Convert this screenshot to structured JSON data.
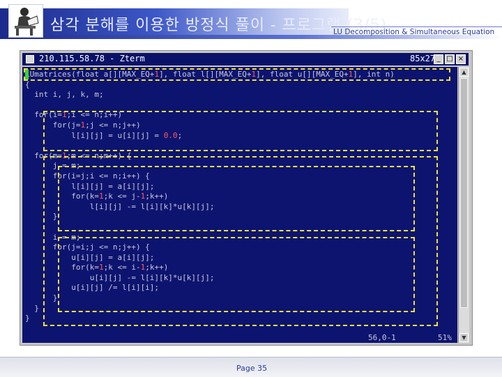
{
  "slide": {
    "title": "삼각 분해를 이용한 방정식 풀이 - 프로그램 (3/5)",
    "subtitle": "LU Decomposition & Simultaneous Equation",
    "page_label": "Page 35"
  },
  "window": {
    "title": "210.115.58.78 - Zterm",
    "size": "85x27",
    "minimize_label": "_",
    "maximize_label": "□",
    "close_label": "×"
  },
  "terminal": {
    "colors": {
      "background": "#0d1470",
      "text": "#c9c9d6",
      "number": "#ff5a5a",
      "cursor": "#3bd23b",
      "highlight_box": "#f2e23a"
    },
    "code_lines": [
      "LUmatrices(float a[][MAX_EQ+1], float l[][MAX_EQ+1], float u[][MAX_EQ+1], int n)",
      "{",
      "  int i, j, k, m;",
      "",
      "  for(i=1;i <= n;i++)",
      "      for(j=1;j <= n;j++)",
      "          l[i][j] = u[i][j] = 0.0;",
      "",
      "  for(m=1;m <= n;m++) {",
      "      j = m;",
      "      for(i=j;i <= n;i++) {",
      "          l[i][j] = a[i][j];",
      "          for(k=1;k <= j-1;k++)",
      "              l[i][j] -= l[i][k]*u[k][j];",
      "      }",
      "",
      "      i = m;",
      "      for(j=i;j <= n;j++) {",
      "          u[i][j] = a[i][j];",
      "          for(k=1;k <= i-1;k++)",
      "              u[i][j] -= l[i][k]*u[k][j];",
      "          u[i][j] /= l[i][i];",
      "      }",
      "  }",
      "}"
    ],
    "status_position": "56,0-1",
    "status_percent": "51%"
  }
}
